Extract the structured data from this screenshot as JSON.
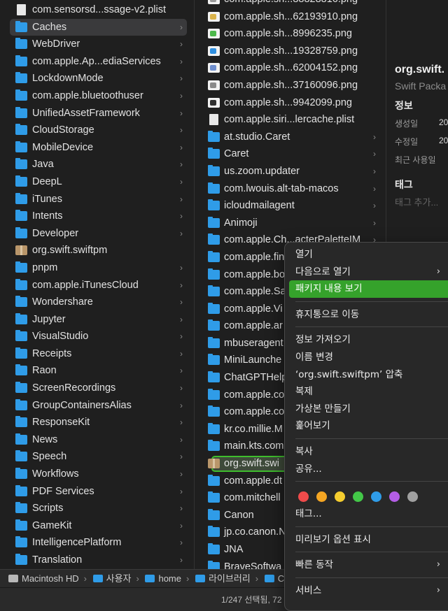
{
  "column1": [
    {
      "label": "com.sensorsd...ssage-v2.plist",
      "kind": "file",
      "chevron": false
    },
    {
      "label": "Caches",
      "kind": "folder",
      "chevron": true,
      "selected": true
    },
    {
      "label": "WebDriver",
      "kind": "folder",
      "chevron": true
    },
    {
      "label": "com.apple.Ap...ediaServices",
      "kind": "folder",
      "chevron": true
    },
    {
      "label": "LockdownMode",
      "kind": "folder",
      "chevron": true
    },
    {
      "label": "com.apple.bluetoothuser",
      "kind": "folder",
      "chevron": true
    },
    {
      "label": "UnifiedAssetFramework",
      "kind": "folder",
      "chevron": true
    },
    {
      "label": "CloudStorage",
      "kind": "folder",
      "chevron": true
    },
    {
      "label": "MobileDevice",
      "kind": "folder",
      "chevron": true
    },
    {
      "label": "Java",
      "kind": "folder",
      "chevron": true
    },
    {
      "label": "DeepL",
      "kind": "folder",
      "chevron": true
    },
    {
      "label": "iTunes",
      "kind": "folder",
      "chevron": true
    },
    {
      "label": "Intents",
      "kind": "folder",
      "chevron": true
    },
    {
      "label": "Developer",
      "kind": "folder",
      "chevron": true
    },
    {
      "label": "org.swift.swiftpm",
      "kind": "package",
      "chevron": false
    },
    {
      "label": "pnpm",
      "kind": "folder",
      "chevron": true
    },
    {
      "label": "com.apple.iTunesCloud",
      "kind": "folder",
      "chevron": true
    },
    {
      "label": "Wondershare",
      "kind": "folder",
      "chevron": true
    },
    {
      "label": "Jupyter",
      "kind": "folder",
      "chevron": true
    },
    {
      "label": "VisualStudio",
      "kind": "folder",
      "chevron": true
    },
    {
      "label": "Receipts",
      "kind": "folder",
      "chevron": true
    },
    {
      "label": "Raon",
      "kind": "folder",
      "chevron": true
    },
    {
      "label": "ScreenRecordings",
      "kind": "folder",
      "chevron": true
    },
    {
      "label": "GroupContainersAlias",
      "kind": "folder",
      "chevron": true
    },
    {
      "label": "ResponseKit",
      "kind": "folder",
      "chevron": true
    },
    {
      "label": "News",
      "kind": "folder",
      "chevron": true
    },
    {
      "label": "Speech",
      "kind": "folder",
      "chevron": true
    },
    {
      "label": "Workflows",
      "kind": "folder",
      "chevron": true
    },
    {
      "label": "PDF Services",
      "kind": "folder",
      "chevron": true
    },
    {
      "label": "Scripts",
      "kind": "folder",
      "chevron": true
    },
    {
      "label": "GameKit",
      "kind": "folder",
      "chevron": true
    },
    {
      "label": "IntelligencePlatform",
      "kind": "folder",
      "chevron": true
    },
    {
      "label": "Translation",
      "kind": "folder",
      "chevron": true
    }
  ],
  "column2": [
    {
      "label": "com.apple.sh...88828816.png",
      "kind": "image",
      "color": "#9a9a9a",
      "chevron": false
    },
    {
      "label": "com.apple.sh...62193910.png",
      "kind": "image",
      "color": "#d9b24a",
      "chevron": false
    },
    {
      "label": "com.apple.sh...8996235.png",
      "kind": "image",
      "color": "#4cb84a",
      "chevron": false
    },
    {
      "label": "com.apple.sh...19328759.png",
      "kind": "image",
      "color": "#2f8fe0",
      "chevron": false
    },
    {
      "label": "com.apple.sh...62004152.png",
      "kind": "image",
      "color": "#6f8fcf",
      "chevron": false
    },
    {
      "label": "com.apple.sh...37160096.png",
      "kind": "image",
      "color": "#8a8a8a",
      "chevron": false
    },
    {
      "label": "com.apple.sh...9942099.png",
      "kind": "image",
      "color": "#303030",
      "chevron": false
    },
    {
      "label": "com.apple.siri...lercache.plist",
      "kind": "file",
      "chevron": false
    },
    {
      "label": "at.studio.Caret",
      "kind": "folder",
      "chevron": true
    },
    {
      "label": "Caret",
      "kind": "folder",
      "chevron": true
    },
    {
      "label": "us.zoom.updater",
      "kind": "folder",
      "chevron": true
    },
    {
      "label": "com.lwouis.alt-tab-macos",
      "kind": "folder",
      "chevron": true
    },
    {
      "label": "icloudmailagent",
      "kind": "folder",
      "chevron": true
    },
    {
      "label": "Animoji",
      "kind": "folder",
      "chevron": true
    },
    {
      "label": "com.apple.Ch...acterPaletteIM",
      "kind": "folder",
      "chevron": true
    },
    {
      "label": "com.apple.fin",
      "kind": "folder",
      "chevron": true
    },
    {
      "label": "com.apple.bo",
      "kind": "folder",
      "chevron": true
    },
    {
      "label": "com.apple.Sa",
      "kind": "folder",
      "chevron": true
    },
    {
      "label": "com.apple.Vi",
      "kind": "folder",
      "chevron": true
    },
    {
      "label": "com.apple.ar",
      "kind": "folder",
      "chevron": true
    },
    {
      "label": "mbuseragent",
      "kind": "folder",
      "chevron": true
    },
    {
      "label": "MiniLaunche",
      "kind": "folder",
      "chevron": true
    },
    {
      "label": "ChatGPTHelp",
      "kind": "folder",
      "chevron": true
    },
    {
      "label": "com.apple.co",
      "kind": "folder",
      "chevron": true
    },
    {
      "label": "com.apple.co",
      "kind": "folder",
      "chevron": true
    },
    {
      "label": "kr.co.millie.M",
      "kind": "folder",
      "chevron": true
    },
    {
      "label": "main.kts.com",
      "kind": "folder",
      "chevron": true
    },
    {
      "label": "org.swift.swi",
      "kind": "package",
      "chevron": false,
      "selected": true
    },
    {
      "label": "com.apple.dt",
      "kind": "folder",
      "chevron": true
    },
    {
      "label": "com.mitchell",
      "kind": "folder",
      "chevron": true
    },
    {
      "label": "Canon",
      "kind": "folder",
      "chevron": true
    },
    {
      "label": "jp.co.canon.N",
      "kind": "folder",
      "chevron": true
    },
    {
      "label": "JNA",
      "kind": "folder",
      "chevron": true
    },
    {
      "label": "BraveSoftwa",
      "kind": "folder",
      "chevron": true
    }
  ],
  "info": {
    "title": "org.swift.",
    "subtitle": "Swift Packa",
    "section_info": "정보",
    "created_label": "생성일",
    "created_value": "20",
    "modified_label": "수정일",
    "modified_value": "20",
    "lastused_label": "최근 사용일",
    "section_tags": "태그",
    "tags_placeholder": "태그 추가..."
  },
  "context_menu": {
    "open": "열기",
    "open_with": "다음으로 열기",
    "show_contents": "패키지 내용 보기",
    "move_to_trash": "휴지통으로 이동",
    "get_info": "정보 가져오기",
    "rename": "이름 변경",
    "compress": "‘org.swift.swiftpm’ 압축",
    "duplicate": "복제",
    "make_alias": "가상본 만들기",
    "quick_look": "훑어보기",
    "copy": "복사",
    "share": "공유...",
    "tags": "태그...",
    "show_preview_options": "미리보기 옵션 표시",
    "quick_actions": "빠른 동작",
    "services": "서비스",
    "tag_colors": [
      "#f04b4b",
      "#f5a623",
      "#f5cd2f",
      "#43c748",
      "#2f9ce8",
      "#b45ee6",
      "#a0a0a0"
    ]
  },
  "pathbar": {
    "crumbs": [
      "Macintosh HD",
      "사용자",
      "home",
      "라이브러리",
      "Cac"
    ]
  },
  "status": "1/247 선택됨, 72"
}
